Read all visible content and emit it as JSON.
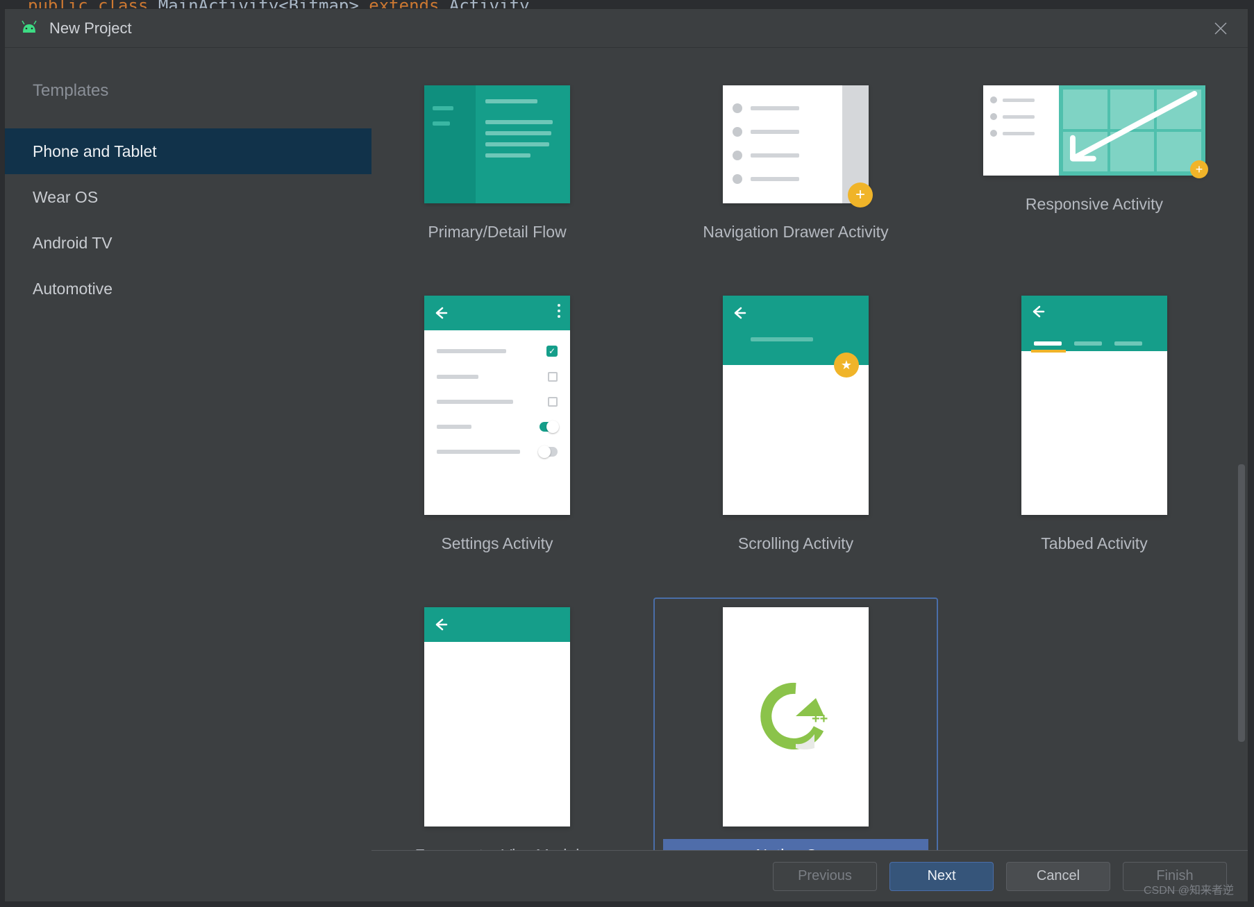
{
  "behind_code": "public class MainActivity<Bitmap> extends Activity",
  "dialog": {
    "title": "New Project"
  },
  "sidebar": {
    "heading": "Templates",
    "items": [
      {
        "label": "Phone and Tablet",
        "active": true
      },
      {
        "label": "Wear OS",
        "active": false
      },
      {
        "label": "Android TV",
        "active": false
      },
      {
        "label": "Automotive",
        "active": false
      }
    ]
  },
  "templates": [
    {
      "label": "Primary/Detail Flow",
      "kind": "primary-detail",
      "short": true,
      "selected": false
    },
    {
      "label": "Navigation Drawer Activity",
      "kind": "nav-drawer",
      "short": true,
      "selected": false
    },
    {
      "label": "Responsive Activity",
      "kind": "responsive",
      "short": true,
      "selected": false
    },
    {
      "label": "Settings Activity",
      "kind": "settings",
      "short": false,
      "selected": false
    },
    {
      "label": "Scrolling Activity",
      "kind": "scrolling",
      "short": false,
      "selected": false
    },
    {
      "label": "Tabbed Activity",
      "kind": "tabbed",
      "short": false,
      "selected": false
    },
    {
      "label": "Fragment + ViewModel",
      "kind": "fragment-vm",
      "short": false,
      "selected": false
    },
    {
      "label": "Native C++",
      "kind": "native-cpp",
      "short": false,
      "selected": true
    }
  ],
  "buttons": {
    "previous": "Previous",
    "next": "Next",
    "cancel": "Cancel",
    "finish": "Finish"
  },
  "watermark": "CSDN @知来者逆"
}
